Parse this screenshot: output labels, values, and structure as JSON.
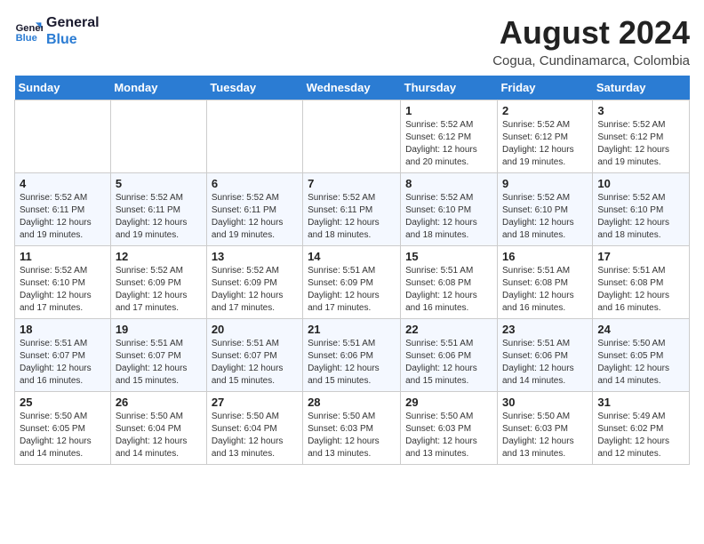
{
  "header": {
    "logo_line1": "General",
    "logo_line2": "Blue",
    "month_title": "August 2024",
    "subtitle": "Cogua, Cundinamarca, Colombia"
  },
  "days_of_week": [
    "Sunday",
    "Monday",
    "Tuesday",
    "Wednesday",
    "Thursday",
    "Friday",
    "Saturday"
  ],
  "weeks": [
    [
      {
        "day": "",
        "info": ""
      },
      {
        "day": "",
        "info": ""
      },
      {
        "day": "",
        "info": ""
      },
      {
        "day": "",
        "info": ""
      },
      {
        "day": "1",
        "info": "Sunrise: 5:52 AM\nSunset: 6:12 PM\nDaylight: 12 hours\nand 20 minutes."
      },
      {
        "day": "2",
        "info": "Sunrise: 5:52 AM\nSunset: 6:12 PM\nDaylight: 12 hours\nand 19 minutes."
      },
      {
        "day": "3",
        "info": "Sunrise: 5:52 AM\nSunset: 6:12 PM\nDaylight: 12 hours\nand 19 minutes."
      }
    ],
    [
      {
        "day": "4",
        "info": "Sunrise: 5:52 AM\nSunset: 6:11 PM\nDaylight: 12 hours\nand 19 minutes."
      },
      {
        "day": "5",
        "info": "Sunrise: 5:52 AM\nSunset: 6:11 PM\nDaylight: 12 hours\nand 19 minutes."
      },
      {
        "day": "6",
        "info": "Sunrise: 5:52 AM\nSunset: 6:11 PM\nDaylight: 12 hours\nand 19 minutes."
      },
      {
        "day": "7",
        "info": "Sunrise: 5:52 AM\nSunset: 6:11 PM\nDaylight: 12 hours\nand 18 minutes."
      },
      {
        "day": "8",
        "info": "Sunrise: 5:52 AM\nSunset: 6:10 PM\nDaylight: 12 hours\nand 18 minutes."
      },
      {
        "day": "9",
        "info": "Sunrise: 5:52 AM\nSunset: 6:10 PM\nDaylight: 12 hours\nand 18 minutes."
      },
      {
        "day": "10",
        "info": "Sunrise: 5:52 AM\nSunset: 6:10 PM\nDaylight: 12 hours\nand 18 minutes."
      }
    ],
    [
      {
        "day": "11",
        "info": "Sunrise: 5:52 AM\nSunset: 6:10 PM\nDaylight: 12 hours\nand 17 minutes."
      },
      {
        "day": "12",
        "info": "Sunrise: 5:52 AM\nSunset: 6:09 PM\nDaylight: 12 hours\nand 17 minutes."
      },
      {
        "day": "13",
        "info": "Sunrise: 5:52 AM\nSunset: 6:09 PM\nDaylight: 12 hours\nand 17 minutes."
      },
      {
        "day": "14",
        "info": "Sunrise: 5:51 AM\nSunset: 6:09 PM\nDaylight: 12 hours\nand 17 minutes."
      },
      {
        "day": "15",
        "info": "Sunrise: 5:51 AM\nSunset: 6:08 PM\nDaylight: 12 hours\nand 16 minutes."
      },
      {
        "day": "16",
        "info": "Sunrise: 5:51 AM\nSunset: 6:08 PM\nDaylight: 12 hours\nand 16 minutes."
      },
      {
        "day": "17",
        "info": "Sunrise: 5:51 AM\nSunset: 6:08 PM\nDaylight: 12 hours\nand 16 minutes."
      }
    ],
    [
      {
        "day": "18",
        "info": "Sunrise: 5:51 AM\nSunset: 6:07 PM\nDaylight: 12 hours\nand 16 minutes."
      },
      {
        "day": "19",
        "info": "Sunrise: 5:51 AM\nSunset: 6:07 PM\nDaylight: 12 hours\nand 15 minutes."
      },
      {
        "day": "20",
        "info": "Sunrise: 5:51 AM\nSunset: 6:07 PM\nDaylight: 12 hours\nand 15 minutes."
      },
      {
        "day": "21",
        "info": "Sunrise: 5:51 AM\nSunset: 6:06 PM\nDaylight: 12 hours\nand 15 minutes."
      },
      {
        "day": "22",
        "info": "Sunrise: 5:51 AM\nSunset: 6:06 PM\nDaylight: 12 hours\nand 15 minutes."
      },
      {
        "day": "23",
        "info": "Sunrise: 5:51 AM\nSunset: 6:06 PM\nDaylight: 12 hours\nand 14 minutes."
      },
      {
        "day": "24",
        "info": "Sunrise: 5:50 AM\nSunset: 6:05 PM\nDaylight: 12 hours\nand 14 minutes."
      }
    ],
    [
      {
        "day": "25",
        "info": "Sunrise: 5:50 AM\nSunset: 6:05 PM\nDaylight: 12 hours\nand 14 minutes."
      },
      {
        "day": "26",
        "info": "Sunrise: 5:50 AM\nSunset: 6:04 PM\nDaylight: 12 hours\nand 14 minutes."
      },
      {
        "day": "27",
        "info": "Sunrise: 5:50 AM\nSunset: 6:04 PM\nDaylight: 12 hours\nand 13 minutes."
      },
      {
        "day": "28",
        "info": "Sunrise: 5:50 AM\nSunset: 6:03 PM\nDaylight: 12 hours\nand 13 minutes."
      },
      {
        "day": "29",
        "info": "Sunrise: 5:50 AM\nSunset: 6:03 PM\nDaylight: 12 hours\nand 13 minutes."
      },
      {
        "day": "30",
        "info": "Sunrise: 5:50 AM\nSunset: 6:03 PM\nDaylight: 12 hours\nand 13 minutes."
      },
      {
        "day": "31",
        "info": "Sunrise: 5:49 AM\nSunset: 6:02 PM\nDaylight: 12 hours\nand 12 minutes."
      }
    ]
  ]
}
